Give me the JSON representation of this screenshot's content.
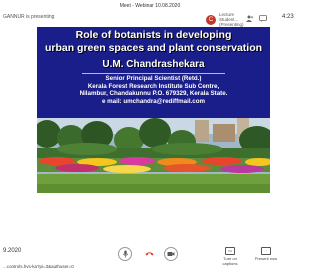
{
  "topbar": {
    "presenting": "GANNUR is presenting",
    "meeting_title": "Meet - Webinar 10.08.2020",
    "participant_initial": "C",
    "participant_name": "Lecture Student... (Presenting)",
    "clock": "4:23"
  },
  "slide": {
    "title_line1": "Role of botanists in developing",
    "title_line2": "urban green spaces and plant conservation",
    "presenter_name": "U.M. Chandrashekara",
    "info_line1": "Senior Principal Scientist (Retd.)",
    "info_line2": "Kerala Forest Research Institute Sub Centre,",
    "info_line3": "Nilambur, Chandakunnu P.O. 679329, Kerala State.",
    "info_line4": "e mail: umchandra@rediffmail.com"
  },
  "bottombar": {
    "meeting_code": "9.2020",
    "url": "...controls.hvs-ka?pi=3&authuser=0",
    "captions_label": "Turn on captions",
    "present_label": "Present now"
  },
  "colors": {
    "slide_background": "#1a1e8a",
    "end_call": "#d93025"
  }
}
